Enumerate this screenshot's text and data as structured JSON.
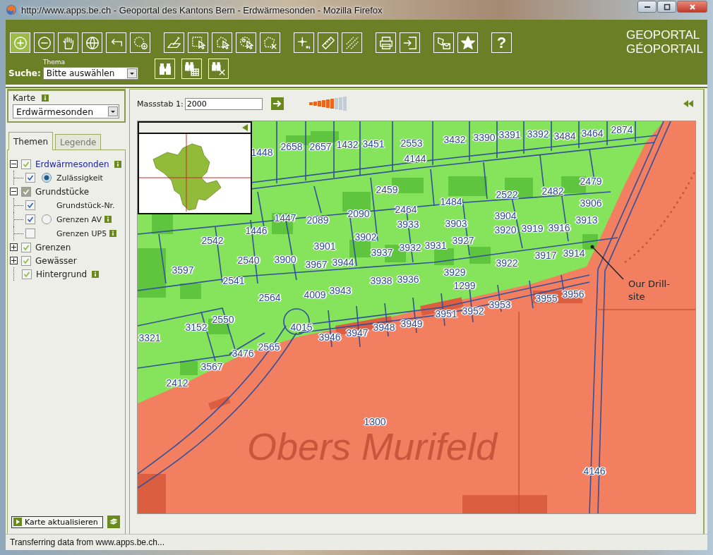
{
  "window": {
    "title": "http://www.apps.be.ch - Geoportal des Kantons Bern - Erdwärmesonden - Mozilla Firefox"
  },
  "toolbar": {
    "tools": [
      {
        "kind": "zoom-in",
        "selected": true
      },
      {
        "kind": "zoom-out",
        "selected": false
      },
      {
        "kind": "pan",
        "selected": false
      },
      {
        "kind": "globe",
        "selected": false
      },
      {
        "kind": "back",
        "selected": false
      },
      {
        "kind": "zoom-area",
        "selected": false
      },
      {
        "kind": "identify",
        "selected": false
      },
      {
        "kind": "select-rect",
        "selected": false
      },
      {
        "kind": "select-polygon",
        "selected": false
      },
      {
        "kind": "select-point",
        "selected": false
      },
      {
        "kind": "clear-selection",
        "selected": false
      },
      {
        "kind": "coordinate",
        "selected": false
      },
      {
        "kind": "measure-distance",
        "selected": false
      },
      {
        "kind": "measure-area",
        "selected": false
      },
      {
        "kind": "print",
        "selected": false
      },
      {
        "kind": "export",
        "selected": false
      },
      {
        "kind": "mail",
        "selected": false
      },
      {
        "kind": "favorite",
        "selected": false
      },
      {
        "kind": "help",
        "selected": false,
        "label": "?"
      }
    ],
    "search_tools": [
      {
        "kind": "search"
      },
      {
        "kind": "search-table"
      },
      {
        "kind": "clear-search"
      }
    ],
    "brand": [
      "GEOPORTAL",
      "GÉOPORTAIL"
    ]
  },
  "search": {
    "label": "Suche:",
    "theme_label": "Thema",
    "value": "Bitte auswählen"
  },
  "sidebar": {
    "map_label": "Karte",
    "map_value": "Erdwärmesonden",
    "tabs": [
      {
        "label": "Themen",
        "selected": true
      },
      {
        "label": "Legende",
        "selected": false
      }
    ],
    "tree": [
      {
        "label": "Erdwärmesonden",
        "checked": true,
        "partial": false,
        "expanded": true,
        "active": true,
        "info": true,
        "children": [
          {
            "label": "Zulässigkeit",
            "checked": true,
            "kind": "radio",
            "selected": true,
            "info": false
          }
        ]
      },
      {
        "label": "Grundstücke",
        "checked": true,
        "partial": true,
        "expanded": true,
        "active": false,
        "info": false,
        "children": [
          {
            "label": "Grundstück-Nr.",
            "checked": true,
            "kind": "plain",
            "info": false
          },
          {
            "label": "Grenzen AV",
            "checked": true,
            "kind": "radio",
            "selected": false,
            "info": true
          },
          {
            "label": "Grenzen UP5",
            "checked": false,
            "kind": "plain",
            "info": true
          }
        ]
      },
      {
        "label": "Grenzen",
        "checked": true,
        "partial": false,
        "expanded": false,
        "active": false,
        "info": false
      },
      {
        "label": "Gewässer",
        "checked": true,
        "partial": false,
        "expanded": false,
        "active": false,
        "info": false
      },
      {
        "label": "Hintergrund",
        "checked": true,
        "partial": false,
        "active": false,
        "info": true
      }
    ],
    "refresh_button": "Karte aktualisieren"
  },
  "map_bar": {
    "scale_label": "Massstab 1:",
    "scale_value": "2000",
    "zoom": {
      "level": 0.67
    }
  },
  "map": {
    "parcels": [
      "1448",
      "2658",
      "2657",
      "1432",
      "3451",
      "2553",
      "4144",
      "3432",
      "3390",
      "3391",
      "3392",
      "3484",
      "3464",
      "2874",
      "2459",
      "2464",
      "1484",
      "2522",
      "2482",
      "2479",
      "3906",
      "2090",
      "1447",
      "2089",
      "3933",
      "3903",
      "3904",
      "3913",
      "3920",
      "3919",
      "3916",
      "1446",
      "2542",
      "3902",
      "3927",
      "3901",
      "3937",
      "3932",
      "3931",
      "3917",
      "3914",
      "2540",
      "3900",
      "3967",
      "3944",
      "3922",
      "3597",
      "3929",
      "2541",
      "3938",
      "3936",
      "1299",
      "2564",
      "4009",
      "3943",
      "3955",
      "3956",
      "3953",
      "3952",
      "3951",
      "2550",
      "3321",
      "3152",
      "4015",
      "3949",
      "3948",
      "3947",
      "3946",
      "2565",
      "3476",
      "3567",
      "2412",
      "1300",
      "4146"
    ],
    "area_label": "Obers Murifeld",
    "annotation": "Our Drill-\nsite"
  },
  "status_bar": "Transferring data from www.apps.be.ch..."
}
